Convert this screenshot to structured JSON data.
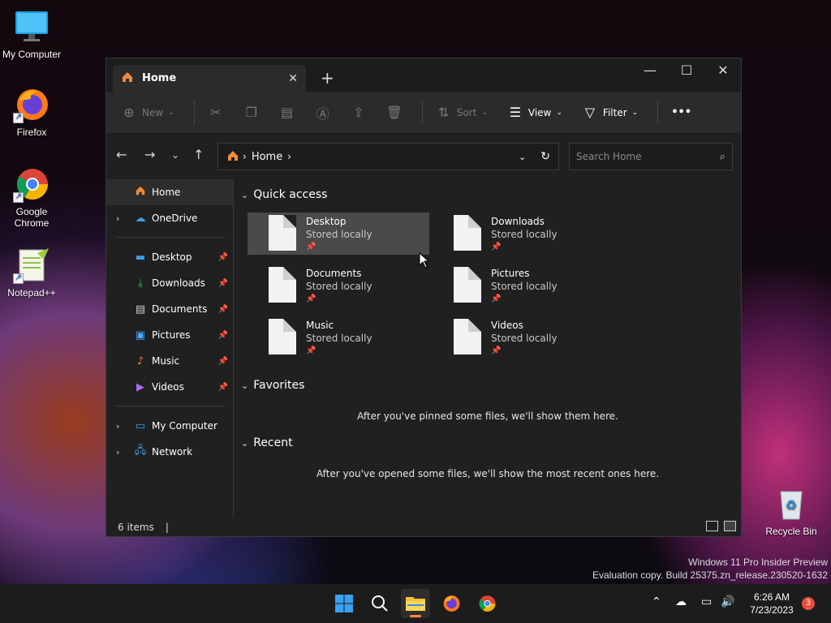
{
  "desktop": {
    "icons": [
      {
        "label": "My Computer"
      },
      {
        "label": "Firefox"
      },
      {
        "label": "Google Chrome"
      },
      {
        "label": "Notepad++"
      },
      {
        "label": "Recycle Bin"
      }
    ]
  },
  "window": {
    "tab_title": "Home",
    "toolbar": {
      "new_label": "New",
      "sort_label": "Sort",
      "view_label": "View",
      "filter_label": "Filter",
      "more_label": "•••"
    },
    "address": {
      "crumbs": [
        "Home"
      ],
      "search_placeholder": "Search Home"
    },
    "sidebar": {
      "items": [
        {
          "label": "Home"
        },
        {
          "label": "OneDrive"
        },
        {
          "label": "Desktop"
        },
        {
          "label": "Downloads"
        },
        {
          "label": "Documents"
        },
        {
          "label": "Pictures"
        },
        {
          "label": "Music"
        },
        {
          "label": "Videos"
        },
        {
          "label": "My Computer"
        },
        {
          "label": "Network"
        }
      ]
    },
    "content": {
      "quick_access": {
        "title": "Quick access",
        "tiles": [
          {
            "name": "Desktop",
            "status": "Stored locally"
          },
          {
            "name": "Downloads",
            "status": "Stored locally"
          },
          {
            "name": "Documents",
            "status": "Stored locally"
          },
          {
            "name": "Pictures",
            "status": "Stored locally"
          },
          {
            "name": "Music",
            "status": "Stored locally"
          },
          {
            "name": "Videos",
            "status": "Stored locally"
          }
        ]
      },
      "favorites": {
        "title": "Favorites",
        "empty": "After you've pinned some files, we'll show them here."
      },
      "recent": {
        "title": "Recent",
        "empty": "After you've opened some files, we'll show the most recent ones here."
      }
    },
    "status": {
      "items": "6 items"
    }
  },
  "watermark": {
    "line1": "Windows 11 Pro Insider Preview",
    "line2": "Evaluation copy. Build 25375.zn_release.230520-1632"
  },
  "taskbar": {
    "time": "6:26 AM",
    "date": "7/23/2023",
    "notifications": "3"
  },
  "colors": {
    "window_bg": "#202020",
    "toolbar_bg": "#2b2b2b",
    "accent_orange": "#ff8a3d",
    "badge_red": "#e9503f"
  }
}
